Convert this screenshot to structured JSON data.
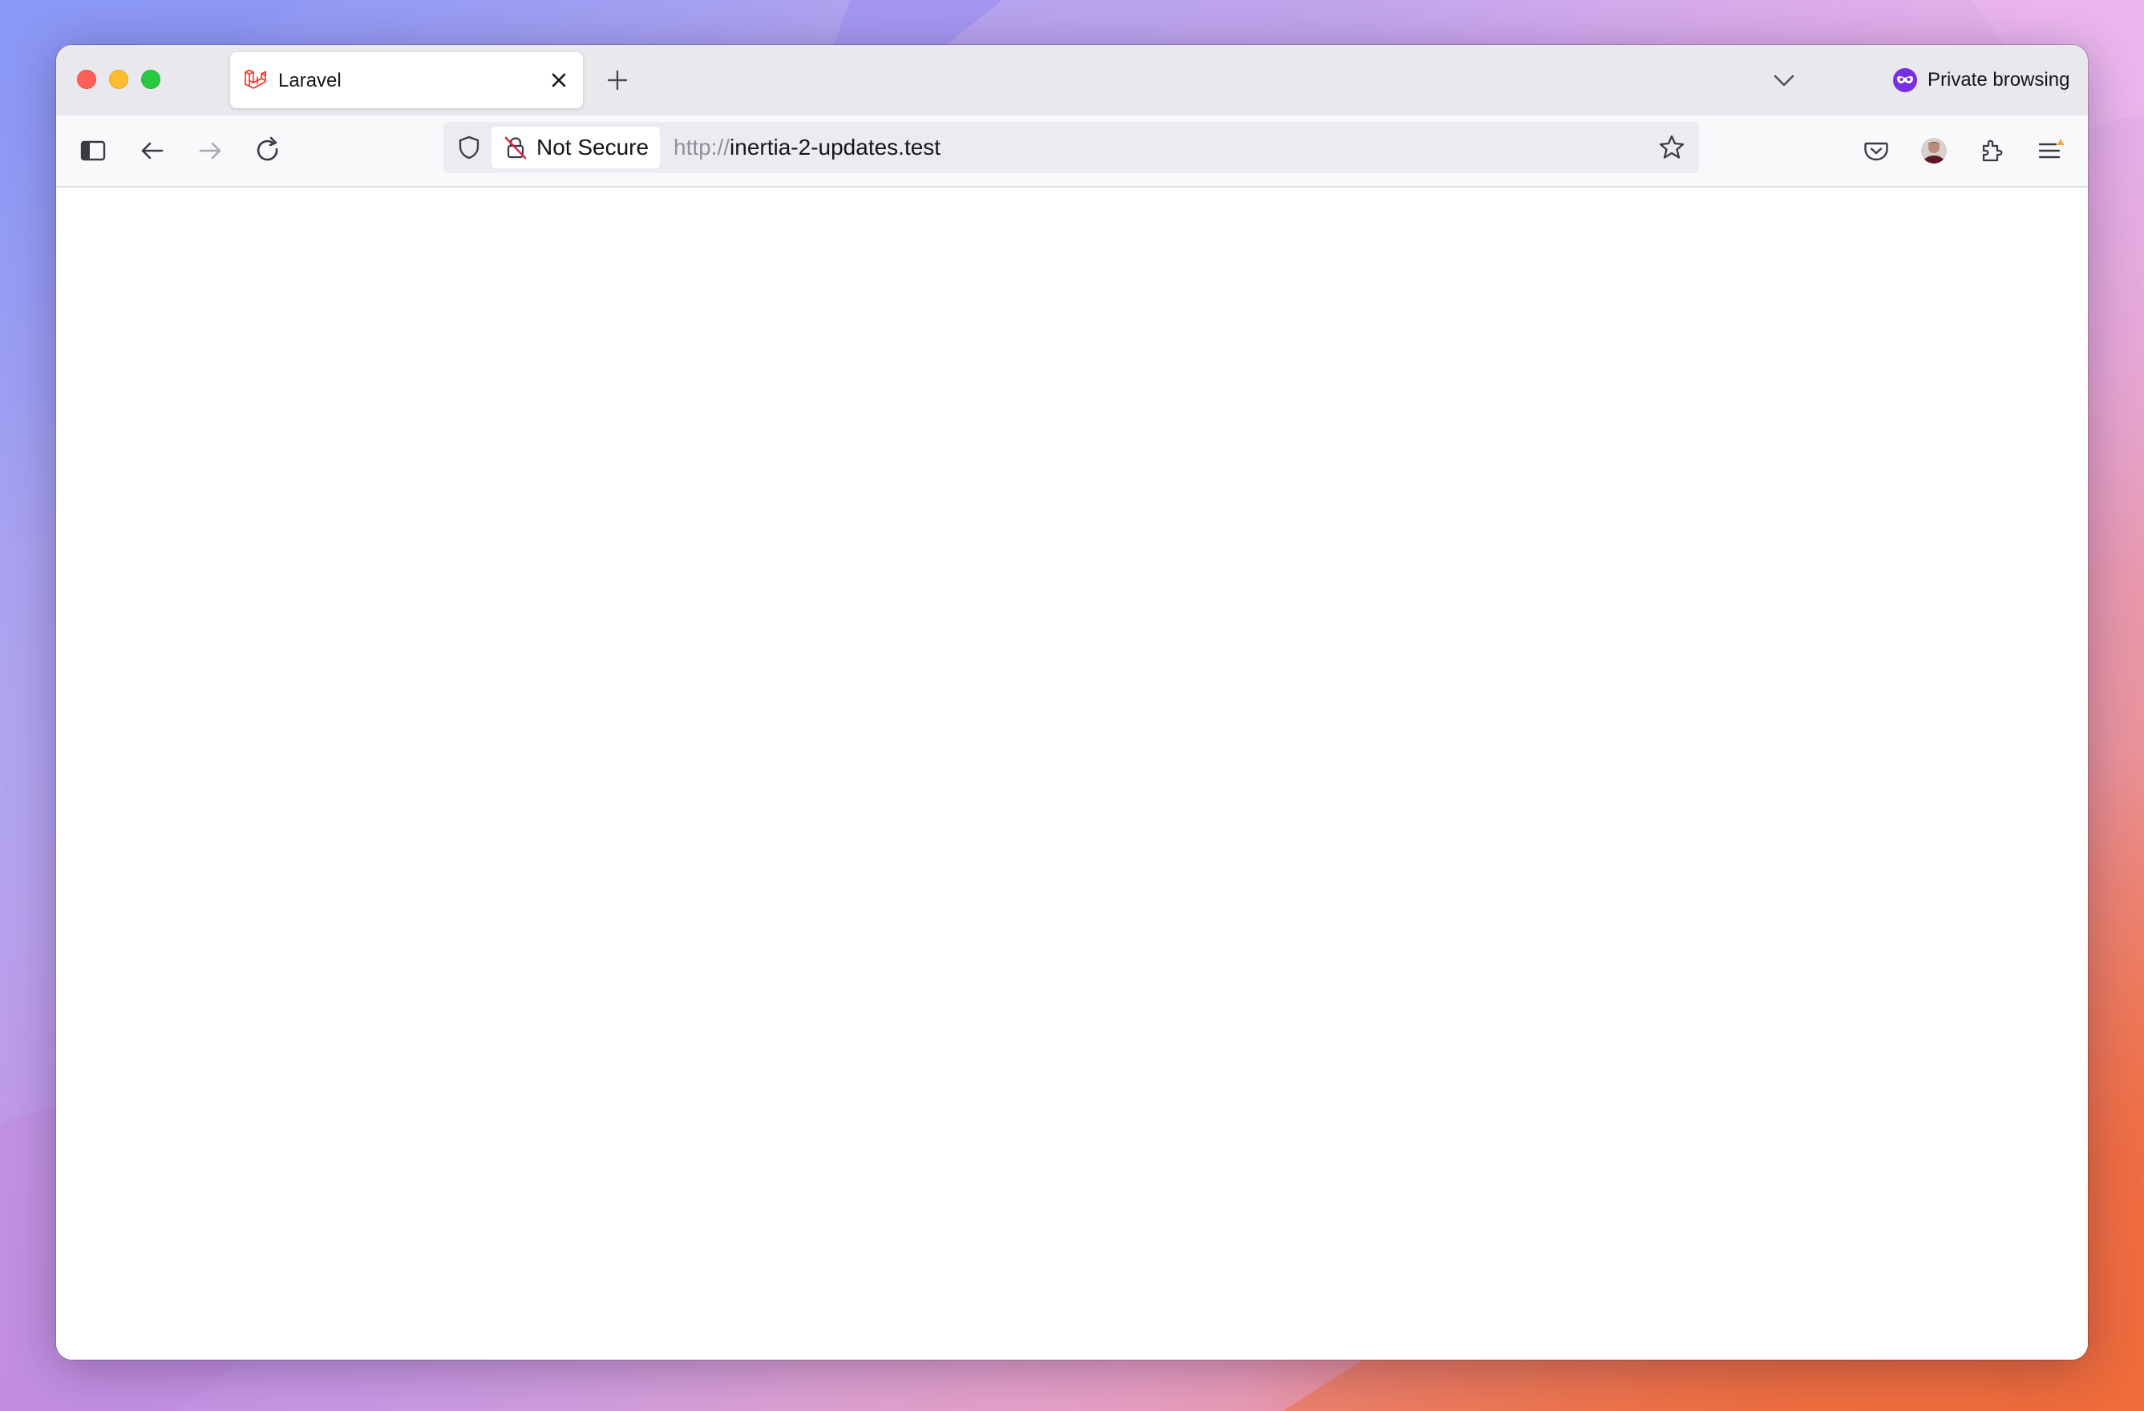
{
  "browser": {
    "active_tab": {
      "title": "Laravel",
      "favicon": "laravel-logo-icon"
    },
    "private_label": "Private browsing",
    "security_label": "Not Secure",
    "url": {
      "scheme": "http://",
      "host": "inertia-2-updates.test"
    }
  },
  "icons": {
    "sidebar": "sidebar-icon",
    "back": "back-arrow-icon",
    "forward": "forward-arrow-icon",
    "reload": "reload-icon",
    "tracking": "shield-icon",
    "insecure": "insecure-lock-icon",
    "bookmark": "star-icon",
    "pocket": "pocket-icon",
    "account": "account-avatar-icon",
    "extensions": "puzzle-piece-icon",
    "menu": "hamburger-menu-icon"
  },
  "colors": {
    "traffic_close": "#ff5f57",
    "traffic_minimize": "#febc2e",
    "traffic_zoom": "#28c840",
    "private_accent": "#7a2ee6",
    "laravel_red": "#ff2d20",
    "notification_badge": "#ffa436"
  }
}
